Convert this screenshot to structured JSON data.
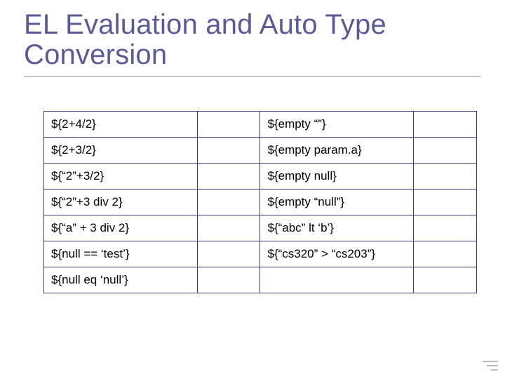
{
  "title": "EL Evaluation and Auto Type Conversion",
  "left": [
    {
      "expr": "${2+4/2}",
      "res": ""
    },
    {
      "expr": "${2+3/2}",
      "res": ""
    },
    {
      "expr": "${“2”+3/2}",
      "res": ""
    },
    {
      "expr": "${“2”+3 div 2}",
      "res": ""
    },
    {
      "expr": "${“a” + 3 div 2}",
      "res": ""
    },
    {
      "expr": "${null == ‘test’}",
      "res": ""
    },
    {
      "expr": "${null eq ‘null’}",
      "res": ""
    }
  ],
  "right": [
    {
      "expr": "${empty “”}",
      "res": ""
    },
    {
      "expr": "${empty param.a}",
      "res": ""
    },
    {
      "expr": "${empty null}",
      "res": ""
    },
    {
      "expr": "${empty “null”}",
      "res": ""
    },
    {
      "expr": "${“abc” lt ‘b’}",
      "res": ""
    },
    {
      "expr": "${“cs320” > “cs203”}",
      "res": ""
    },
    {
      "expr": "",
      "res": ""
    }
  ]
}
